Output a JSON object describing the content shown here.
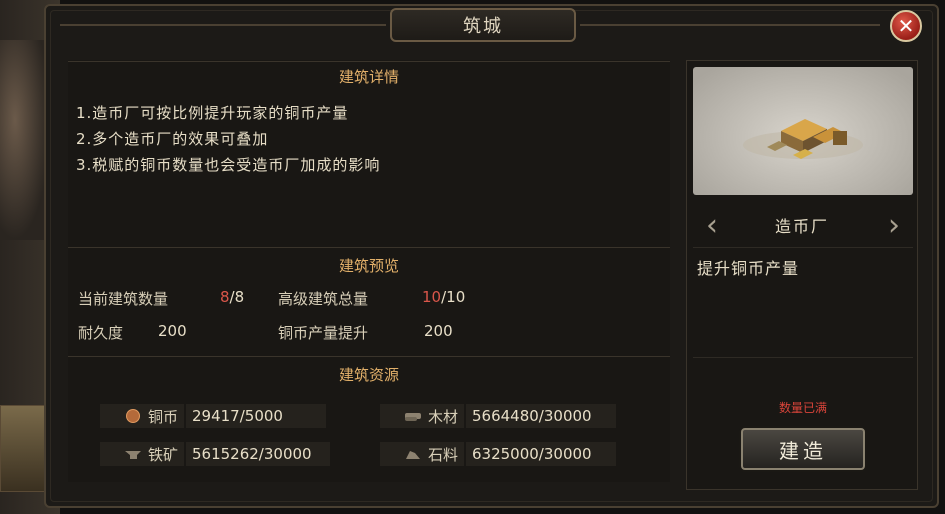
{
  "window": {
    "title": "筑城"
  },
  "close_icon": "close-icon",
  "details": {
    "header": "建筑详情",
    "lines": [
      "1.造币厂可按比例提升玩家的铜币产量",
      "2.多个造币厂的效果可叠加",
      "3.税赋的铜币数量也会受造币厂加成的影响"
    ]
  },
  "preview": {
    "header": "建筑预览",
    "current_count_label": "当前建筑数量",
    "current_count": "8",
    "current_count_max": "/8",
    "advanced_total_label": "高级建筑总量",
    "advanced_total": "10",
    "advanced_total_max": "/10",
    "durability_label": "耐久度",
    "durability": "200",
    "copper_boost_label": "铜币产量提升",
    "copper_boost": "200"
  },
  "resources": {
    "header": "建筑资源",
    "items": [
      {
        "name": "铜币",
        "value": "29417/5000",
        "icon": "copper-coin-icon"
      },
      {
        "name": "木材",
        "value": "5664480/30000",
        "icon": "wood-icon"
      },
      {
        "name": "铁矿",
        "value": "5615262/30000",
        "icon": "iron-ore-icon"
      },
      {
        "name": "石料",
        "value": "6325000/30000",
        "icon": "stone-icon"
      }
    ]
  },
  "building": {
    "name": "造币厂",
    "description": "提升铜币产量",
    "status_note": "数量已满",
    "build_label": "建造"
  },
  "colors": {
    "accent_header": "#e2b06a",
    "alert_red": "#d9564a"
  }
}
